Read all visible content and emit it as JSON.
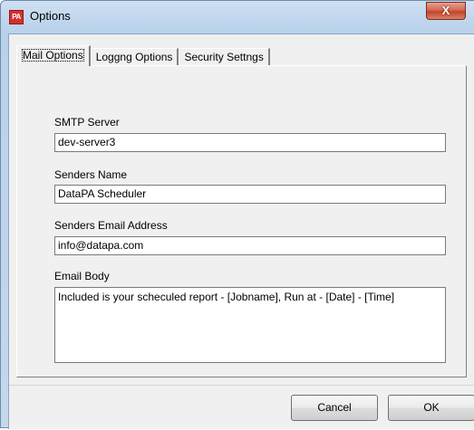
{
  "window": {
    "title": "Options",
    "app_icon_text": "PA",
    "close_glyph": "X"
  },
  "tabs": [
    {
      "label": "Mail Options",
      "active": true
    },
    {
      "label": "Loggng Options",
      "active": false
    },
    {
      "label": "Security Settngs",
      "active": false
    }
  ],
  "mail_options": {
    "smtp_server_label": "SMTP Server",
    "smtp_server_value": "dev-server3",
    "senders_name_label": "Senders Name",
    "senders_name_value": "DataPA Scheduler",
    "senders_email_label": "Senders Email Address",
    "senders_email_value": "info@datapa.com",
    "email_body_label": "Email Body",
    "email_body_value": "Included is your scheculed report - [Jobname], Run at - [Date] - [Time]"
  },
  "buttons": {
    "cancel_label": "Cancel",
    "ok_label": "OK"
  },
  "colors": {
    "close_button": "#c2442a",
    "app_icon": "#d2312e"
  }
}
